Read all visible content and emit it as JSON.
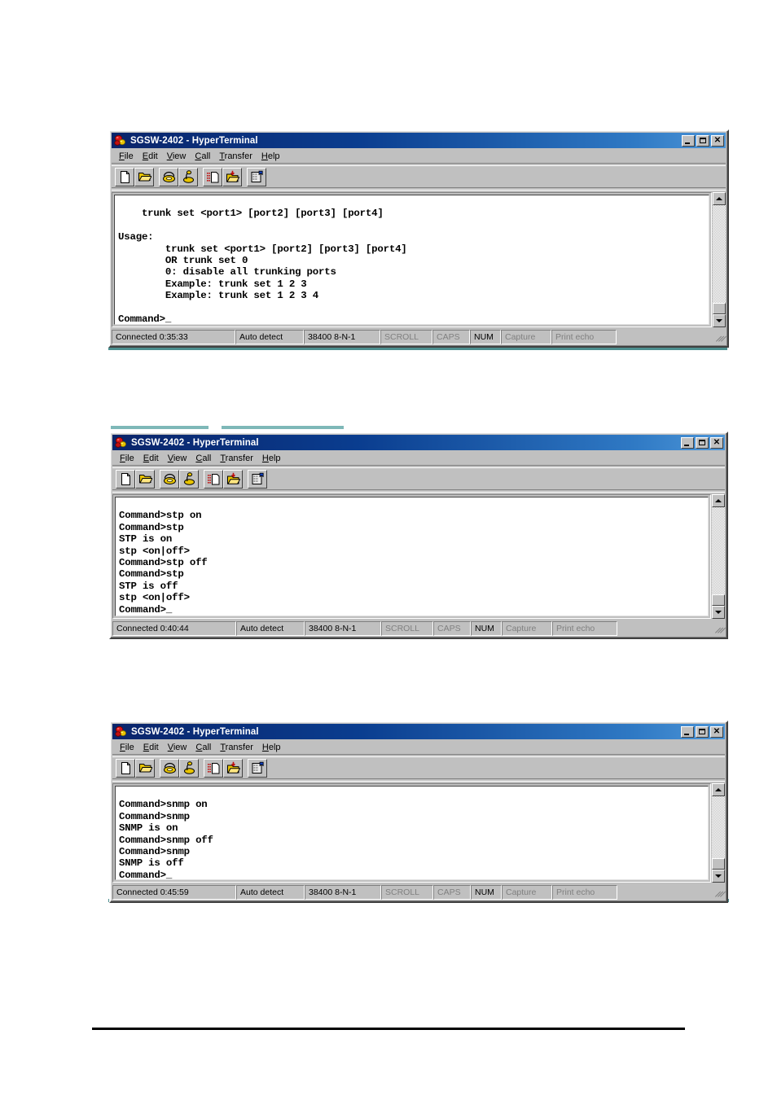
{
  "page": {
    "background_color": "#ffffff",
    "footer_rule_color": "#000000"
  },
  "window_chrome": {
    "title": "SGSW-2402 - HyperTerminal",
    "icon": "hyperterminal-icon",
    "menu": [
      {
        "label": "File",
        "accel": "F"
      },
      {
        "label": "Edit",
        "accel": "E"
      },
      {
        "label": "View",
        "accel": "V"
      },
      {
        "label": "Call",
        "accel": "C"
      },
      {
        "label": "Transfer",
        "accel": "T"
      },
      {
        "label": "Help",
        "accel": "H"
      }
    ],
    "caption_buttons": [
      {
        "name": "minimize-button",
        "glyph": "_"
      },
      {
        "name": "maximize-button",
        "glyph": "□"
      },
      {
        "name": "close-button",
        "glyph": "X"
      }
    ],
    "toolbar": [
      {
        "name": "new-connection-button",
        "icon": "new-document-icon"
      },
      {
        "name": "open-button",
        "icon": "open-folder-icon"
      },
      {
        "name": "call-button",
        "icon": "telephone-icon"
      },
      {
        "name": "disconnect-button",
        "icon": "telephone-hangup-icon"
      },
      {
        "name": "send-file-button",
        "icon": "send-document-icon"
      },
      {
        "name": "receive-file-button",
        "icon": "receive-folder-icon"
      },
      {
        "name": "properties-button",
        "icon": "properties-icon"
      }
    ],
    "scrollbar": {
      "up_arrow": "scroll-up-arrow-icon",
      "down_arrow": "scroll-down-arrow-icon"
    },
    "title_gradient_start": "#0a246a",
    "title_gradient_end": "#4d96d8"
  },
  "windows": [
    {
      "id": "trunk-set-window",
      "title": "SGSW-2402 - HyperTerminal",
      "terminal_lines": [
        "    trunk set <port1> [port2] [port3] [port4]",
        "",
        "Usage:",
        "        trunk set <port1> [port2] [port3] [port4]",
        "        OR trunk set 0",
        "        0: disable all trunking ports",
        "        Example: trunk set 1 2 3",
        "        Example: trunk set 1 2 3 4",
        "",
        "Command>_"
      ],
      "status": {
        "connected": "Connected 0:35:33",
        "detect": "Auto detect",
        "line_settings": "38400 8-N-1",
        "scroll": "SCROLL",
        "caps": "CAPS",
        "num": "NUM",
        "capture": "Capture",
        "print_echo": "Print echo"
      }
    },
    {
      "id": "stp-window",
      "title": "SGSW-2402 - HyperTerminal",
      "terminal_lines": [
        "Command>stp on",
        "Command>stp",
        "STP is on",
        "stp <on|off>",
        "Command>stp off",
        "Command>stp",
        "STP is off",
        "stp <on|off>",
        "Command>_"
      ],
      "status": {
        "connected": "Connected 0:40:44",
        "detect": "Auto detect",
        "line_settings": "38400 8-N-1",
        "scroll": "SCROLL",
        "caps": "CAPS",
        "num": "NUM",
        "capture": "Capture",
        "print_echo": "Print echo"
      }
    },
    {
      "id": "snmp-window",
      "title": "SGSW-2402 - HyperTerminal",
      "terminal_lines": [
        "Command>snmp on",
        "Command>snmp",
        "SNMP is on",
        "Command>snmp off",
        "Command>snmp",
        "SNMP is off",
        "Command>_"
      ],
      "status": {
        "connected": "Connected 0:45:59",
        "detect": "Auto detect",
        "line_settings": "38400 8-N-1",
        "scroll": "SCROLL",
        "caps": "CAPS",
        "num": "NUM",
        "capture": "Capture",
        "print_echo": "Print echo"
      }
    }
  ]
}
